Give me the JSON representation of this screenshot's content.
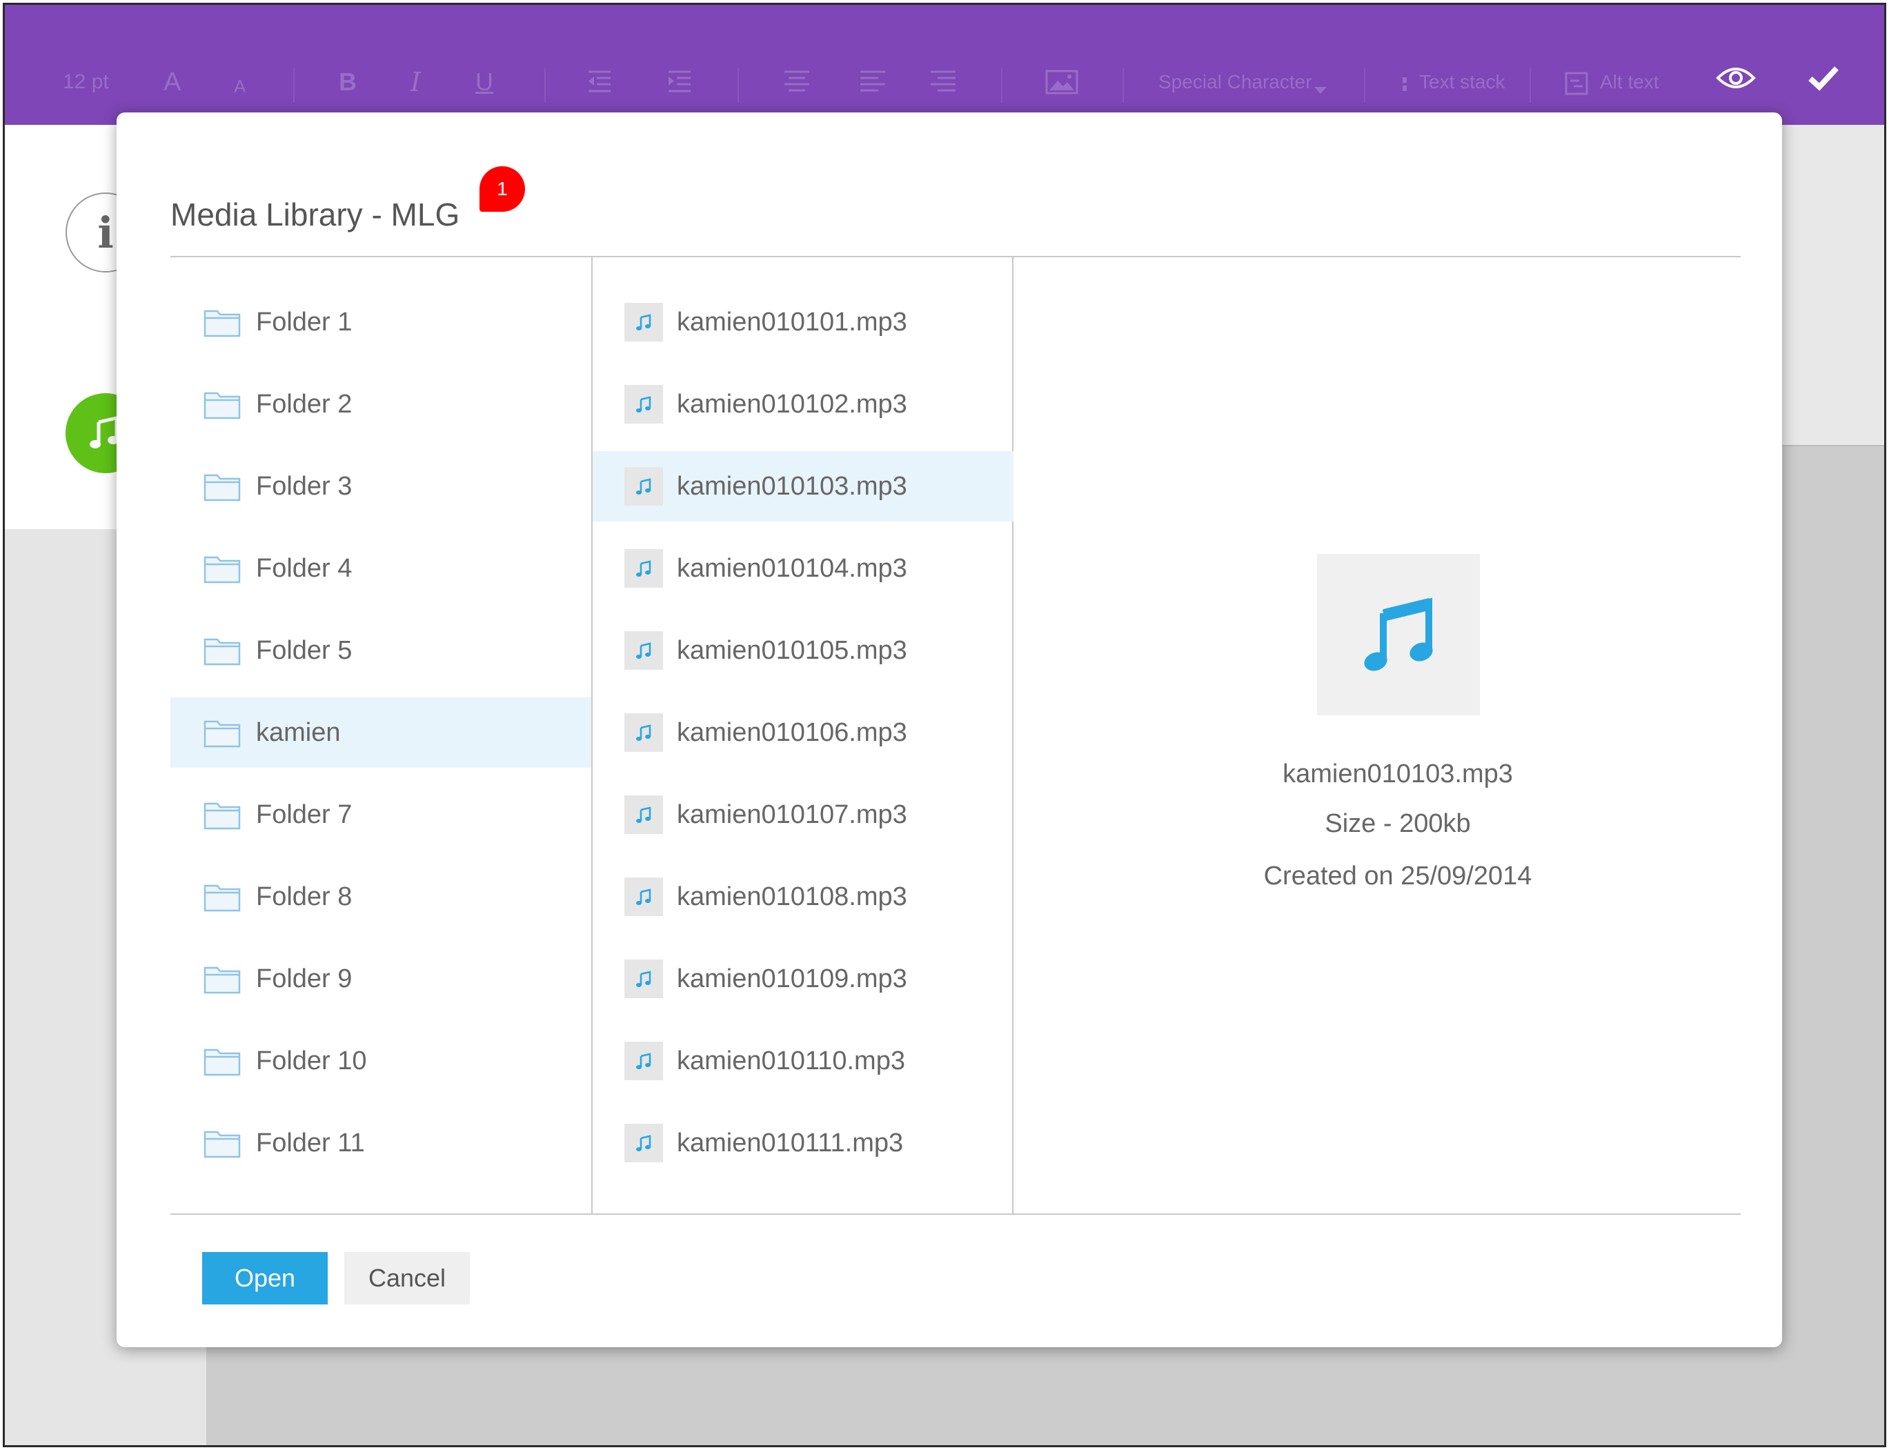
{
  "toolbar": {
    "font_size": "12 pt",
    "font_grow": "A",
    "font_shrink": "A",
    "bold": "B",
    "italic": "I",
    "underline": "U",
    "special_character": "Special Character",
    "text_stack": "Text stack",
    "alt_text": "Alt text",
    "background_color": "#7e46b6"
  },
  "dialog": {
    "title": "Media Library - MLG",
    "badge_count": "1",
    "folders": [
      {
        "label": "Folder 1"
      },
      {
        "label": "Folder 2"
      },
      {
        "label": "Folder 3"
      },
      {
        "label": "Folder 4"
      },
      {
        "label": "Folder 5"
      },
      {
        "label": "kamien",
        "selected": true
      },
      {
        "label": "Folder 7"
      },
      {
        "label": "Folder 8"
      },
      {
        "label": "Folder 9"
      },
      {
        "label": "Folder 10"
      },
      {
        "label": "Folder 11"
      }
    ],
    "files": [
      {
        "label": "kamien010101.mp3"
      },
      {
        "label": "kamien010102.mp3"
      },
      {
        "label": "kamien010103.mp3",
        "selected": true
      },
      {
        "label": "kamien010104.mp3"
      },
      {
        "label": "kamien010105.mp3"
      },
      {
        "label": "kamien010106.mp3"
      },
      {
        "label": "kamien010107.mp3"
      },
      {
        "label": "kamien010108.mp3"
      },
      {
        "label": "kamien010109.mp3"
      },
      {
        "label": "kamien010110.mp3"
      },
      {
        "label": "kamien010111.mp3"
      }
    ],
    "preview": {
      "icon": "music-note-icon",
      "filename": "kamien010103.mp3",
      "size": "Size - 200kb",
      "created": "Created on 25/09/2014"
    },
    "buttons": {
      "open": "Open",
      "cancel": "Cancel"
    }
  },
  "colors": {
    "accent_blue": "#27a6e1",
    "selected_row": "#e8f4fb",
    "badge_red": "#ff0000",
    "music_green": "#5fc117"
  }
}
